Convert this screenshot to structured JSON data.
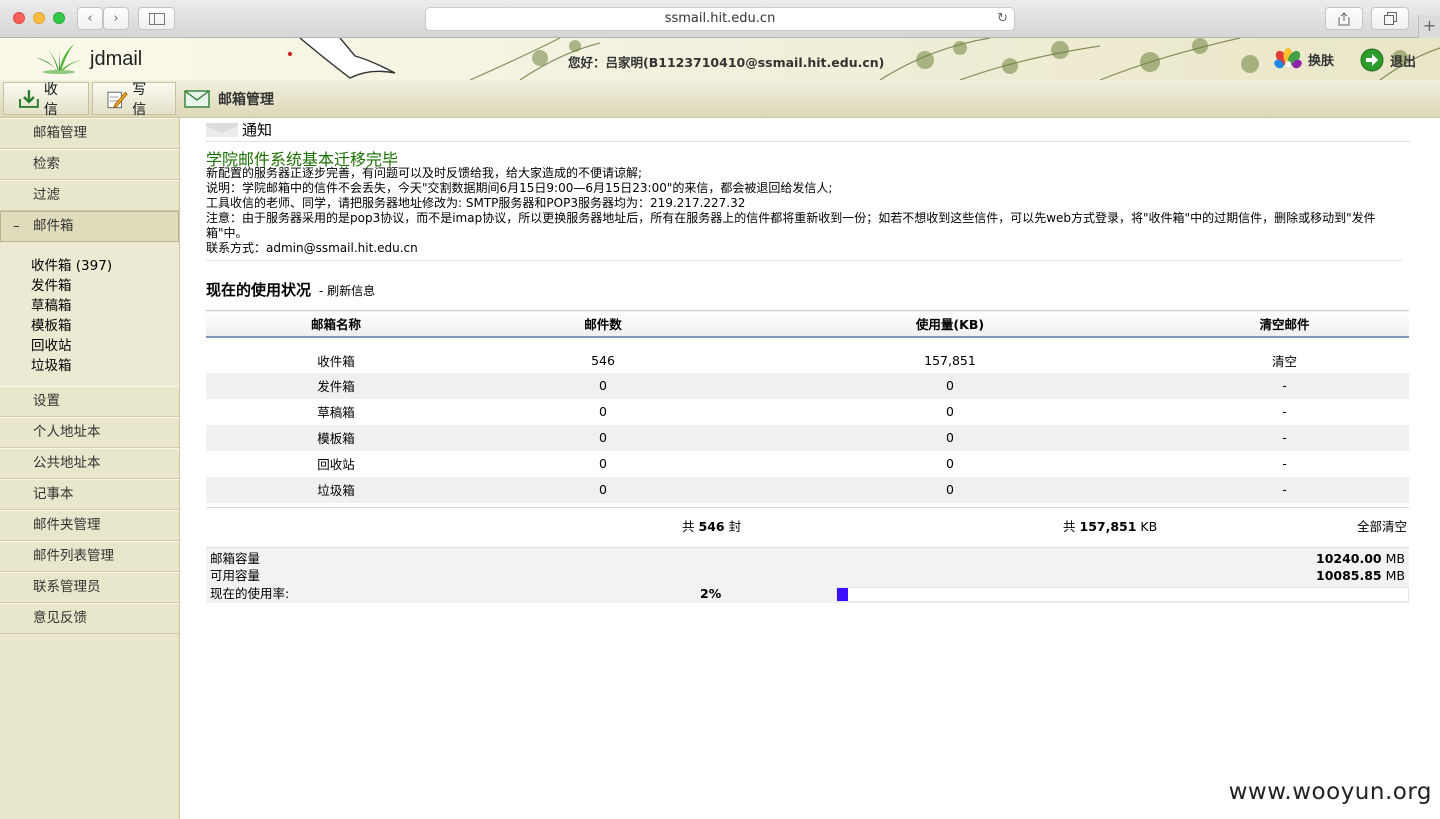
{
  "browser": {
    "url": "ssmail.hit.edu.cn"
  },
  "header": {
    "logo_text": "jdmail",
    "greeting": "您好：吕家明(B1123710410@ssmail.hit.edu.cn)",
    "skin_label": "换肤",
    "logout_label": "退出"
  },
  "toolbar": {
    "receive_label": "收 信",
    "compose_label": "写 信",
    "section_title": "邮箱管理"
  },
  "sidebar": {
    "top_items": [
      "邮箱管理",
      "检索",
      "过滤"
    ],
    "active_item": "邮件箱",
    "active_marker": "–",
    "mailboxes": [
      "收件箱 (397)",
      "发件箱",
      "草稿箱",
      "模板箱",
      "回收站",
      "垃圾箱"
    ],
    "bottom_items": [
      "设置",
      "个人地址本",
      "公共地址本",
      "记事本",
      "邮件夹管理",
      "邮件列表管理",
      "联系管理员",
      "意见反馈"
    ]
  },
  "notice": {
    "label": "通知",
    "title": "学院邮件系统基本迁移完毕",
    "lines": [
      "新配置的服务器正逐步完善，有问题可以及时反馈给我，给大家造成的不便请谅解;",
      "说明：学院邮箱中的信件不会丢失，今天\"交割数据期间6月15日9:00—6月15日23:00\"的来信，都会被退回给发信人;",
      "工具收信的老师、同学，请把服务器地址修改为: SMTP服务器和POP3服务器均为：219.217.227.32",
      "注意：由于服务器采用的是pop3协议，而不是imap协议，所以更换服务器地址后，所有在服务器上的信件都将重新收到一份；如若不想收到这些信件，可以先web方式登录，将\"收件箱\"中的过期信件，删除或移动到\"发件箱\"中。",
      "联系方式：admin@ssmail.hit.edu.cn"
    ]
  },
  "usage": {
    "title": "现在的使用状况",
    "refresh_label": "- 刷新信息",
    "columns": [
      "邮箱名称",
      "邮件数",
      "使用量(KB)",
      "清空邮件"
    ],
    "rows": [
      [
        "收件箱",
        "546",
        "157,851",
        "清空"
      ],
      [
        "发件箱",
        "0",
        "0",
        "-"
      ],
      [
        "草稿箱",
        "0",
        "0",
        "-"
      ],
      [
        "模板箱",
        "0",
        "0",
        "-"
      ],
      [
        "回收站",
        "0",
        "0",
        "-"
      ],
      [
        "垃圾箱",
        "0",
        "0",
        "-"
      ]
    ],
    "total_count_prefix": "共",
    "total_count": "546",
    "total_count_suffix": "封",
    "total_size_prefix": "共",
    "total_size": "157,851",
    "total_size_suffix": "KB",
    "clear_all_label": "全部清空"
  },
  "capacity": {
    "capacity_label": "邮箱容量",
    "capacity_value": "10240.00",
    "capacity_unit": "MB",
    "available_label": "可用容量",
    "available_value": "10085.85",
    "available_unit": "MB",
    "usage_rate_label": "现在的使用率:",
    "usage_rate": "2%",
    "usage_fraction": 0.02,
    "bar_color": "#3c10ff"
  },
  "watermark": "www.wooyun.org"
}
